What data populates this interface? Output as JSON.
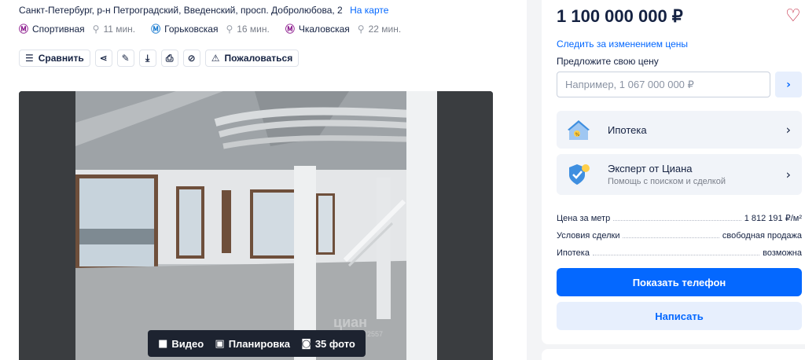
{
  "listing": {
    "address": "Санкт-Петербург, р-н Петроградский, Введенский, просп. Добролюбова, 2",
    "map_link": "На карте",
    "metro": [
      {
        "icon": "metro-icon",
        "name": "Спортивная",
        "time": "11 мин.",
        "color": "#8d1d8f"
      },
      {
        "icon": "metro-icon",
        "name": "Горьковская",
        "time": "16 мин.",
        "color": "#1a7bd0"
      },
      {
        "icon": "metro-icon",
        "name": "Чкаловская",
        "time": "22 мин.",
        "color": "#8d1d8f"
      }
    ]
  },
  "toolbar": {
    "compare_label": "Сравнить",
    "report_label": "Пожаловаться",
    "icons": [
      "compare-icon",
      "share-icon",
      "edit-icon",
      "download-icon",
      "print-icon",
      "hide-icon",
      "warning-icon"
    ]
  },
  "gallery": {
    "video_label": "Видео",
    "plan_label": "Планировка",
    "photos_label": "35 фото",
    "watermark": "циан",
    "watermark_code": "418772557"
  },
  "sidebar": {
    "price": "1 100 000 000 ₽",
    "follow_link": "Следить за изменением цены",
    "offer_label": "Предложите свою цену",
    "offer_placeholder": "Например, 1 067 000 000 ₽",
    "mortgage_title": "Ипотека",
    "expert_title": "Эксперт от Циана",
    "expert_subtitle": "Помощь с поиском и сделкой",
    "facts": [
      {
        "label": "Цена за метр",
        "value": "1 812 191 ₽/м²"
      },
      {
        "label": "Условия сделки",
        "value": "свободная продажа"
      },
      {
        "label": "Ипотека",
        "value": "возможна"
      }
    ],
    "phone_button": "Показать телефон",
    "write_button": "Написать"
  },
  "colors": {
    "accent": "#0468ff",
    "accent_light": "#e7effd",
    "favorite": "#c0213b"
  }
}
